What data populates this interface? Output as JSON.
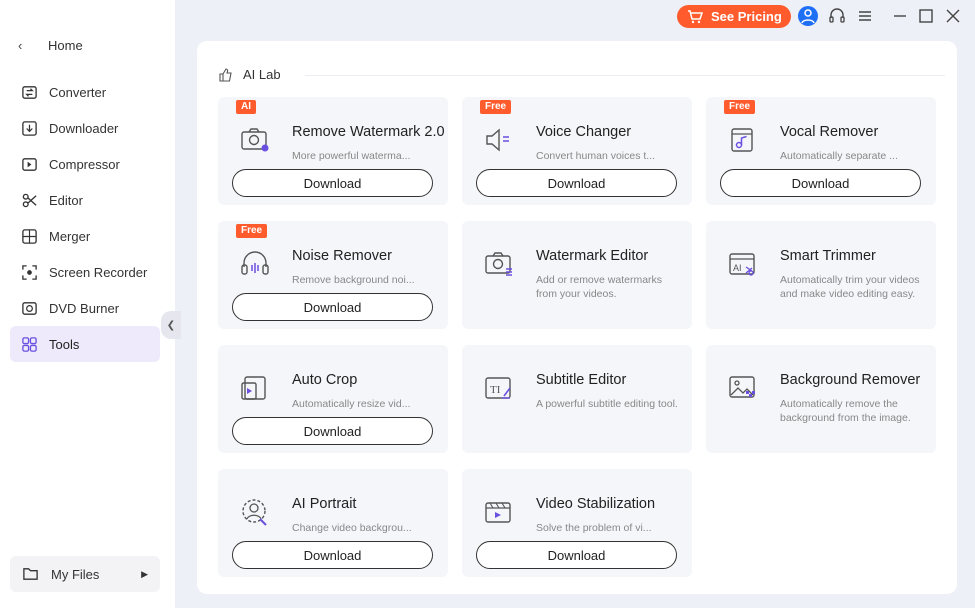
{
  "sidebar": {
    "home_label": "Home",
    "items": [
      {
        "label": "Converter",
        "icon": "converter-icon"
      },
      {
        "label": "Downloader",
        "icon": "downloader-icon"
      },
      {
        "label": "Compressor",
        "icon": "compressor-icon"
      },
      {
        "label": "Editor",
        "icon": "scissors-icon"
      },
      {
        "label": "Merger",
        "icon": "merger-icon"
      },
      {
        "label": "Screen Recorder",
        "icon": "screen-recorder-icon"
      },
      {
        "label": "DVD Burner",
        "icon": "dvd-icon"
      },
      {
        "label": "Tools",
        "icon": "tools-grid-icon",
        "active": true
      }
    ],
    "my_files_label": "My Files"
  },
  "topbar": {
    "pricing_label": "See Pricing",
    "accent": "#ff5b2d"
  },
  "section": {
    "title": "AI Lab"
  },
  "tools": [
    {
      "badge": "AI",
      "title": "Remove Watermark 2.0",
      "desc": "More powerful waterma...",
      "button": "Download",
      "icon": "camera-ai-icon"
    },
    {
      "badge": "Free",
      "title": "Voice Changer",
      "desc": "Convert human voices t...",
      "button": "Download",
      "icon": "speaker-icon"
    },
    {
      "badge": "Free",
      "title": "Vocal Remover",
      "desc": "Automatically separate ...",
      "button": "Download",
      "icon": "music-note-icon"
    },
    {
      "badge": "Free",
      "title": "Noise Remover",
      "desc": "Remove background noi...",
      "button": "Download",
      "icon": "headphones-icon"
    },
    {
      "badge": "",
      "title": "Watermark Editor",
      "desc": "Add or remove watermarks from your videos.",
      "button": "",
      "icon": "camera-edit-icon"
    },
    {
      "badge": "",
      "title": "Smart Trimmer",
      "desc": "Automatically trim your videos and make video editing easy.",
      "button": "",
      "icon": "ai-trimmer-icon"
    },
    {
      "badge": "",
      "title": "Auto Crop",
      "desc": "Automatically resize vid...",
      "button": "Download",
      "icon": "auto-crop-icon"
    },
    {
      "badge": "",
      "title": "Subtitle Editor",
      "desc": "A powerful subtitle editing tool.",
      "button": "",
      "icon": "subtitle-icon"
    },
    {
      "badge": "",
      "title": "Background Remover",
      "desc": "Automatically remove the background from the image.",
      "button": "",
      "icon": "image-remove-icon"
    },
    {
      "badge": "",
      "title": "AI  Portrait",
      "desc": "Change video backgrou...",
      "button": "Download",
      "icon": "portrait-icon"
    },
    {
      "badge": "",
      "title": "Video Stabilization",
      "desc": "Solve the problem of vi...",
      "button": "Download",
      "icon": "stabilization-icon"
    }
  ]
}
